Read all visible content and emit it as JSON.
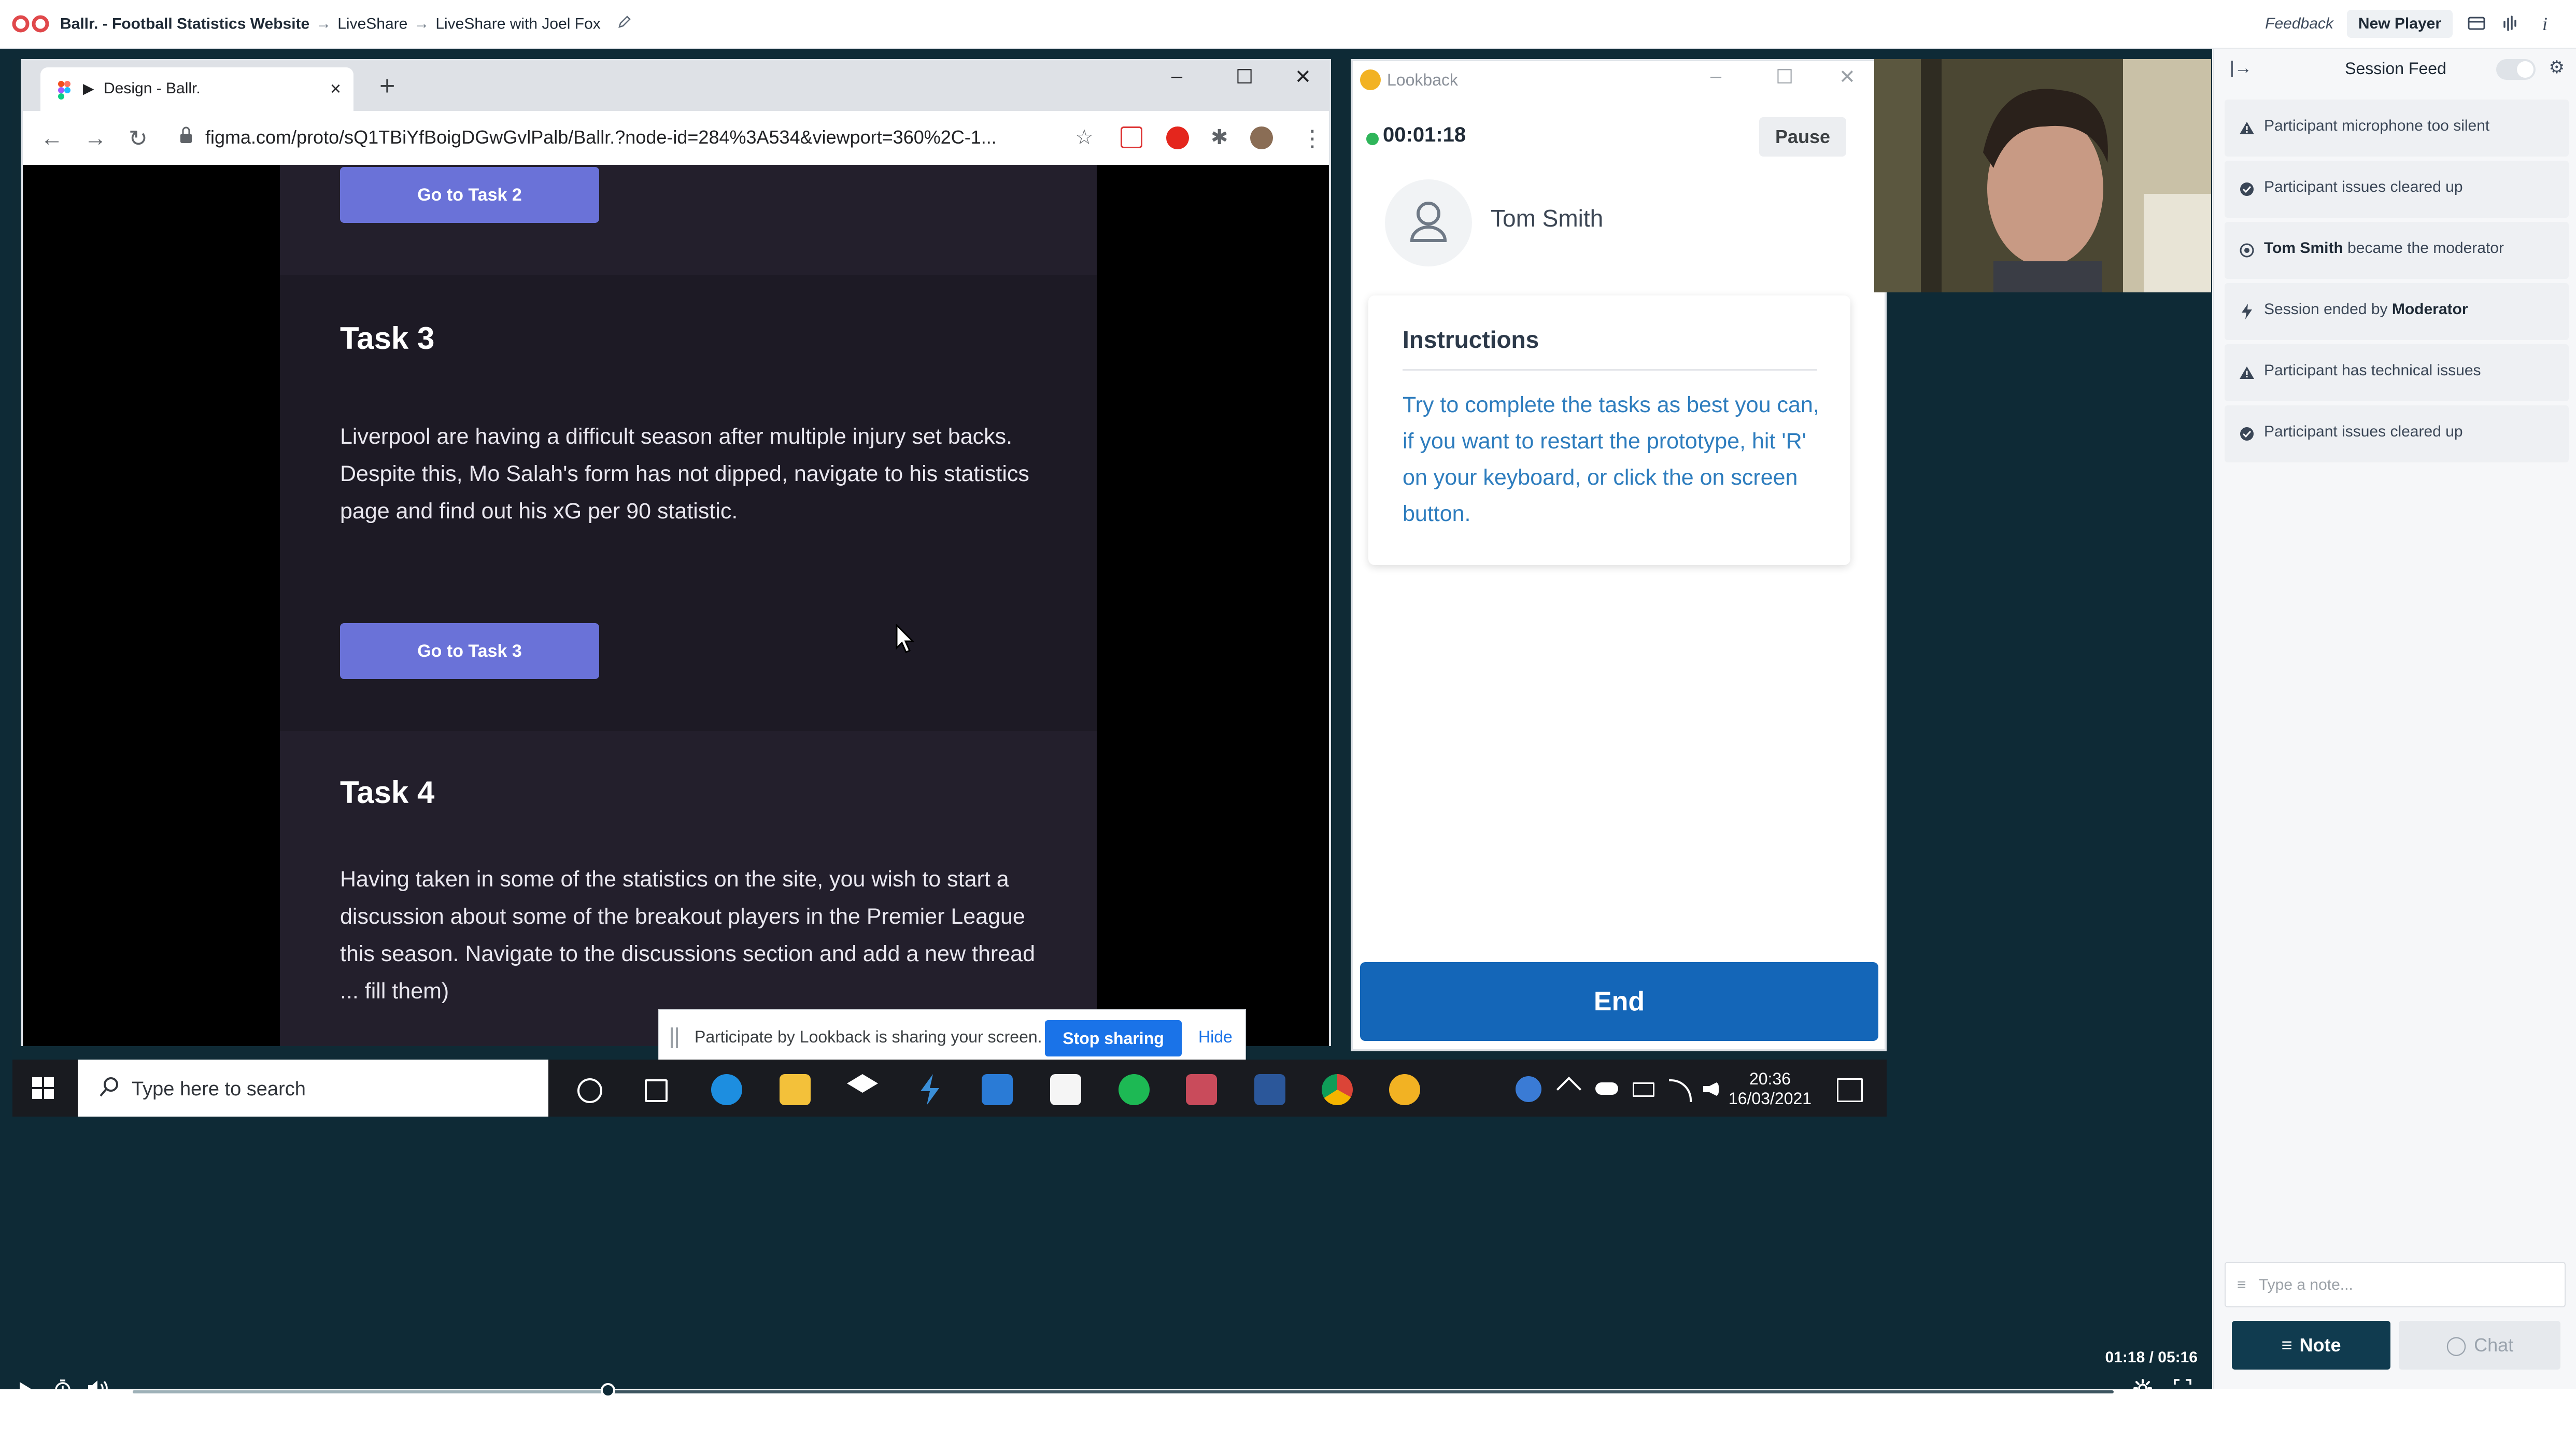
{
  "header": {
    "project": "Ballr. - Football Statistics Website",
    "crumb_1": "LiveShare",
    "crumb_2": "LiveShare with Joel Fox",
    "arrow": "→",
    "feedback": "Feedback",
    "new_player": "New Player"
  },
  "browser": {
    "tab_title": "Design - Ballr.",
    "url": "figma.com/proto/sQ1TBiYfBoigDGwGvlPalb/Ballr.?node-id=284%3A534&viewport=360%2C-1..."
  },
  "prototype": {
    "task2_button": "Go to Task 2",
    "task3_heading": "Task 3",
    "task3_text": "Liverpool are having a difficult season after multiple injury set backs. Despite this, Mo Salah's form has not dipped, navigate to his statistics page and find out his xG per 90 statistic.",
    "task3_button": "Go to Task 3",
    "task4_heading": "Task 4",
    "task4_text": "Having taken in some of the statistics on the site, you wish to start a discussion about some of the breakout players in the Premier League this season. Navigate to the discussions section and add a new thread ... fill them)"
  },
  "share_bar": {
    "message": "Participate by Lookback is sharing your screen.",
    "stop": "Stop sharing",
    "hide": "Hide"
  },
  "lookback": {
    "title": "Lookback",
    "timer": "00:01:18",
    "pause": "Pause",
    "participant": "Tom Smith",
    "instructions_heading": "Instructions",
    "instructions_text": "Try to complete the tasks as best you can, if you want to restart the prototype, hit 'R' on your keyboard, or click the on screen button.",
    "end": "End"
  },
  "taskbar": {
    "search_placeholder": "Type here to search",
    "time": "20:36",
    "date": "16/03/2021"
  },
  "player": {
    "time": "01:18 / 05:16",
    "progress": 0.24
  },
  "panel": {
    "title": "Session Feed",
    "feed": [
      {
        "icon": "warning-icon",
        "text": "Participant microphone too silent"
      },
      {
        "icon": "check-circle-icon",
        "text": "Participant issues cleared up"
      },
      {
        "icon": "moderator-icon",
        "bold": "Tom Smith",
        "text": " became the moderator"
      },
      {
        "icon": "lightning-icon",
        "text": "Session ended by ",
        "bold_end": "Moderator"
      },
      {
        "icon": "warning-icon",
        "text": "Participant has technical issues"
      },
      {
        "icon": "check-circle-icon",
        "text": "Participant issues cleared up"
      }
    ],
    "note_placeholder": "Type a note...",
    "note_button": "Note",
    "chat_button": "Chat"
  },
  "colors": {
    "video_bg": "#0e2a36",
    "accent_blue": "#1466b8",
    "figma_button": "#6a72d8",
    "note_button": "#103b4f"
  }
}
